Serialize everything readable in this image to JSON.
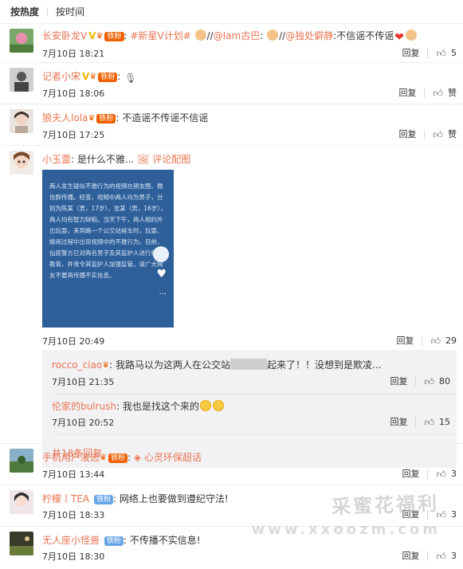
{
  "sort": {
    "hot": "按热度",
    "time": "按时间"
  },
  "actions": {
    "reply": "回复",
    "like": "赞"
  },
  "comments": [
    {
      "user": "长安卧龙V",
      "badge": "铁粉",
      "text_prefix": "#新星V计划#",
      "text_a": "//",
      "mention1": "@Iam古巴",
      "text_b": ":",
      "text_c": "//",
      "mention2": "@独处僻静",
      "text_d": ":不信谣不传谣",
      "time": "7月10日 18:21",
      "likes": "5"
    },
    {
      "user": "记者小宋",
      "badge": "铁粉",
      "time": "7月10日 18:06"
    },
    {
      "user": "狼夫人lola",
      "badge": "铁粉",
      "text": "不造谣不传谣不信谣",
      "time": "7月10日 17:25"
    },
    {
      "user": "小玉蕾",
      "text": "是什么不雅...",
      "piclink": "评论配图",
      "pic_text": "两人发生疑似不雅行为的视频在朋友圈、微信群传播。经查，视频中两人均为男子，分别为陈某（男，17岁）、张某（男，16岁），两人均有智力缺陷。当天下午，两人相约外出玩耍，来到路一个公交站候车时，玩耍、嬉闹过程中出现视频中的不雅行为。目前，仙居警方已对两名男子及其监护人进行批评教育，并责令其监护人加强监管。请广大网友不要再传播不实信息。",
      "time": "7月10日 20:49",
      "likes": "29",
      "replies": [
        {
          "user": "rocco_ciao",
          "text_a": "我路马以为这两人在公交站",
          "text_b": "起来了！！没想到是欺凌...",
          "time": "7月10日 21:35",
          "likes": "80"
        },
        {
          "user": "伦家的bulrush",
          "text": "我也是找这个来的",
          "time": "7月10日 20:52",
          "likes": "15"
        }
      ],
      "more": "共18条回复"
    },
    {
      "user": "手机用户凌志",
      "badge": "铁粉",
      "tag": "心灵环保超话",
      "time": "7月10日 13:44",
      "likes": "3"
    },
    {
      "user": "柠檬丨TEA",
      "badge": "铁粉",
      "text": "网络上也要做到遵纪守法!",
      "time": "7月10日 18:33",
      "likes": "3"
    },
    {
      "user": "无人座小怪兽",
      "badge": "铁粉",
      "text": "不传播不实信息!",
      "time": "7月10日 18:30",
      "likes": "3"
    }
  ],
  "watermark": {
    "line1": "采蜜花福利",
    "line2": "www.xxoozm.com"
  },
  "colors": {
    "accent": "#eb7350",
    "badge": "#f06000",
    "badge_blue": "#67a4e6",
    "reply_bg": "#f2f2f5"
  }
}
